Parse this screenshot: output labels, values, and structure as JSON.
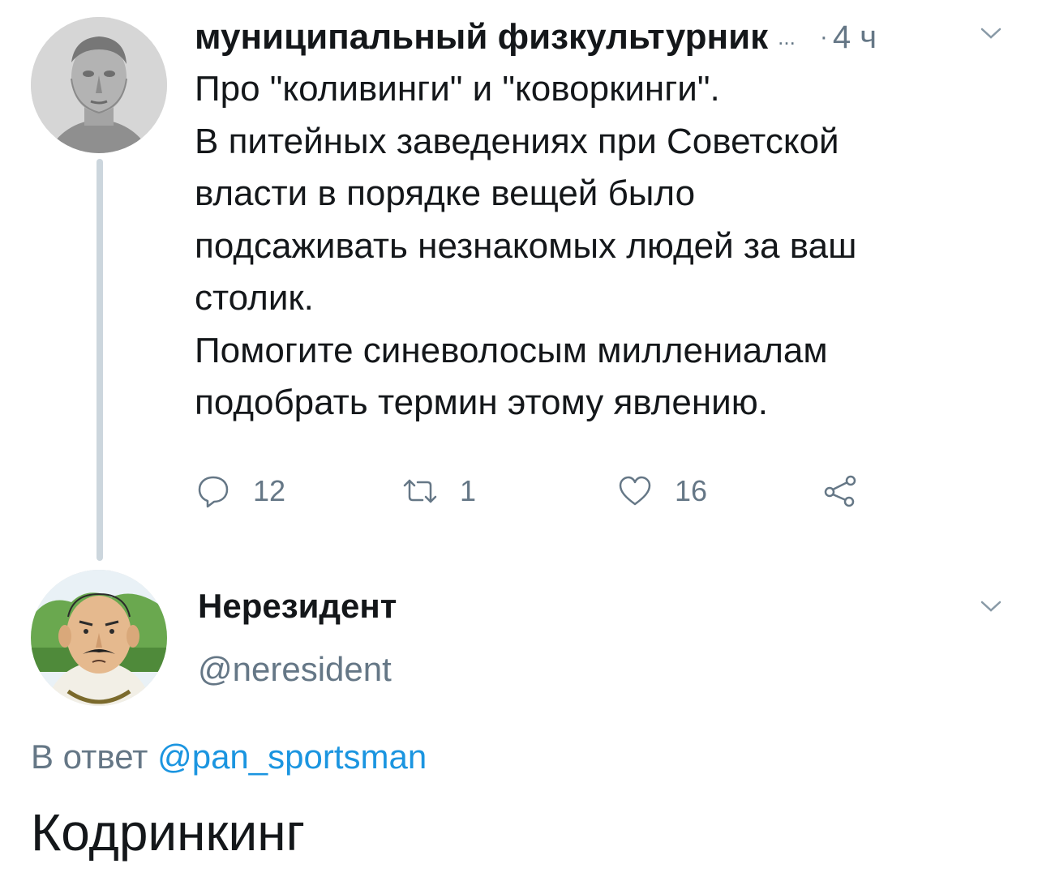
{
  "tweet": {
    "author_name": "муниципальный физкультурник",
    "name_overflow": "...",
    "separator": "·",
    "time": "4 ч",
    "avatar": "roman-bust-avatar",
    "lines": [
      "Про \"коливинги\" и \"коворкинги\".",
      "В питейных заведениях при Советской",
      "власти в порядке вещей было",
      "подсаживать незнакомых людей за ваш",
      "столик.",
      "Помогите синеволосым миллениалам",
      "подобрать термин этому явлению."
    ],
    "actions": {
      "reply_count": "12",
      "retweet_count": "1",
      "like_count": "16"
    }
  },
  "reply": {
    "author_name": "Нерезидент",
    "handle": "@neresident",
    "avatar": "cartoon-man-avatar",
    "reply_to_prefix": "В ответ",
    "reply_to_mention": "@pan_sportsman",
    "text": "Кодринкинг"
  },
  "colors": {
    "text": "#14171a",
    "secondary": "#657786",
    "link": "#1b95e0",
    "thread_line": "#ccd6dd"
  },
  "icons": [
    "reply-icon",
    "retweet-icon",
    "like-icon",
    "share-icon",
    "chevron-down-icon"
  ]
}
